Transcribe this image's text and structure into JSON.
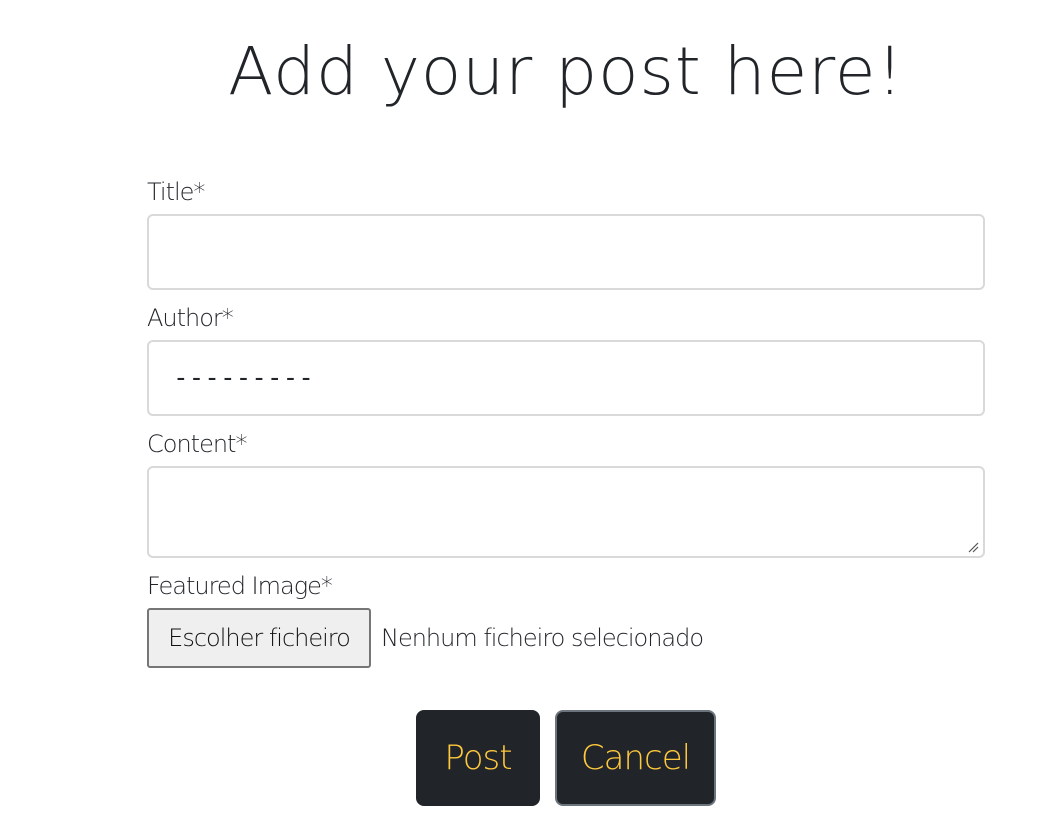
{
  "page": {
    "title": "Add your post here!"
  },
  "form": {
    "title_label": "Title*",
    "title_value": "",
    "author_label": "Author*",
    "author_value": "---------",
    "content_label": "Content*",
    "content_value": "",
    "image_label": "Featured Image*",
    "file_button_label": "Escolher ficheiro",
    "file_status": "Nenhum ficheiro selecionado"
  },
  "actions": {
    "post_label": "Post",
    "cancel_label": "Cancel"
  },
  "colors": {
    "text": "#212529",
    "button_bg": "#212529",
    "button_text": "#ffc83d",
    "input_border": "#d9d9d9"
  }
}
